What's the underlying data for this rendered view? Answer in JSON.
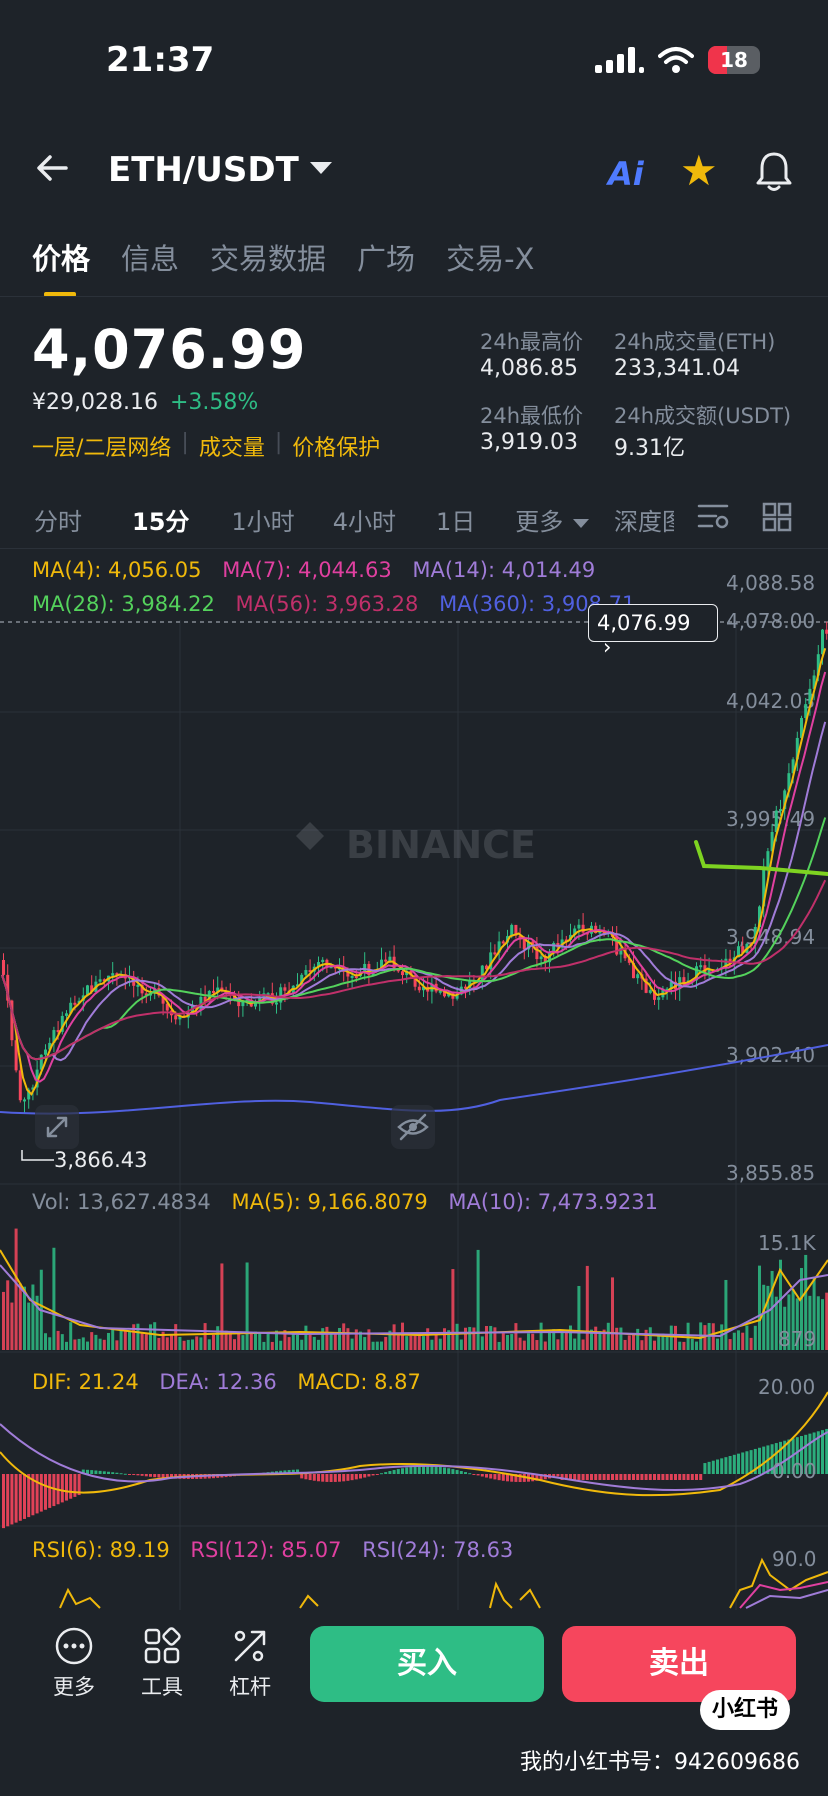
{
  "status_bar": {
    "time": "21:37",
    "battery": "18"
  },
  "header": {
    "pair": "ETH/USDT",
    "ai_label": "Ai"
  },
  "tabs": [
    "价格",
    "信息",
    "交易数据",
    "广场",
    "交易-X"
  ],
  "price": {
    "last": "4,076.99",
    "cny": "¥29,028.16",
    "change": "+3.58%",
    "links": [
      "一层/二层网络",
      "成交量",
      "价格保护"
    ]
  },
  "stats": {
    "high_label": "24h最高价",
    "high": "4,086.85",
    "vol_label": "24h成交量(ETH)",
    "vol": "233,341.04",
    "low_label": "24h最低价",
    "low": "3,919.03",
    "amt_label": "24h成交额(USDT)",
    "amt": "9.31亿"
  },
  "intervals": [
    "分时",
    "15分",
    "1小时",
    "4小时",
    "1日",
    "更多",
    "深度图"
  ],
  "ma": {
    "ma4": "MA(4): 4,056.05",
    "ma7": "MA(7): 4,044.63",
    "ma14": "MA(14): 4,014.49",
    "ma28": "MA(28): 3,984.22",
    "ma56": "MA(56): 3,963.28",
    "ma360": "MA(360): 3,908.71"
  },
  "chart": {
    "y_ticks": [
      "4,088.58",
      "4,078.00",
      "4,042.03",
      "3,995.49",
      "3,948.94",
      "3,902.40",
      "3,855.85"
    ],
    "current_price": "4,076.99",
    "low_marker": "3,866.43",
    "watermark": "BINANCE"
  },
  "volume": {
    "vol": "Vol: 13,627.4834",
    "ma5": "MA(5): 9,166.8079",
    "ma10": "MA(10): 7,473.9231",
    "tick_top": "15.1K",
    "tick_bottom": "879"
  },
  "macd": {
    "dif": "DIF: 21.24",
    "dea": "DEA: 12.36",
    "macd": "MACD: 8.87",
    "tick_top": "20.00",
    "tick_mid": "0.00"
  },
  "rsi": {
    "rsi6": "RSI(6): 89.19",
    "rsi12": "RSI(12): 85.07",
    "rsi24": "RSI(24): 78.63",
    "tick_top": "90.0"
  },
  "bottom": {
    "more": "更多",
    "tools": "工具",
    "leverage": "杠杆",
    "buy": "买入",
    "sell": "卖出",
    "xhs_badge": "小红书",
    "xhs_id": "我的小红书号：942609686"
  },
  "colors": {
    "up": "#2ebd85",
    "down": "#f6465d",
    "accent": "#f0b90b",
    "ma4": "#f0b90b",
    "ma7": "#e040a0",
    "ma14": "#a07cd8",
    "ma28": "#54d25c",
    "ma56": "#c0306a",
    "ma360": "#5060e0"
  }
}
